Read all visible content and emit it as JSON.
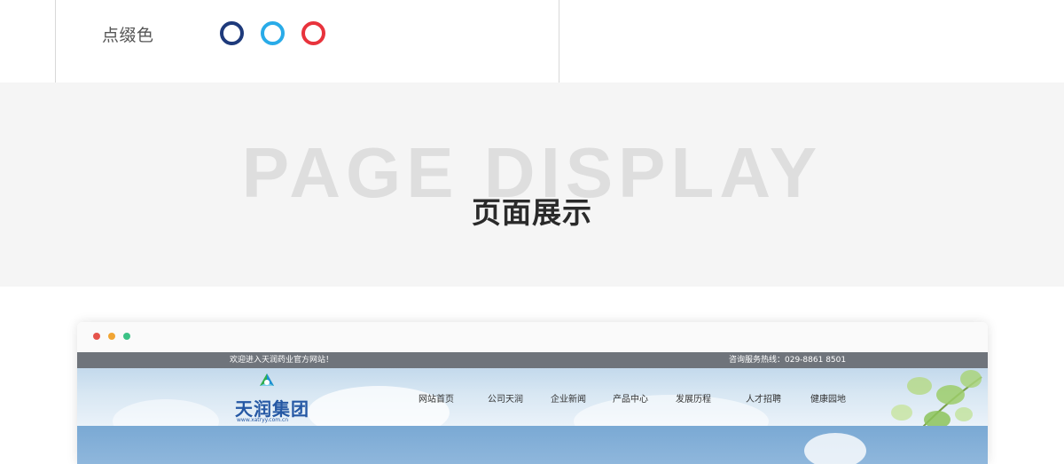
{
  "accent": {
    "label": "点缀色",
    "swatches": [
      {
        "name": "dark-blue",
        "color": "#1e3a7b"
      },
      {
        "name": "sky-blue",
        "color": "#29abe8"
      },
      {
        "name": "red",
        "color": "#e8333c"
      }
    ]
  },
  "banner": {
    "title_en": "PAGE DISPLAY",
    "title_cn": "页面展示"
  },
  "browser": {
    "dots": [
      "#e5534b",
      "#f1a534",
      "#3cc286"
    ],
    "site": {
      "welcome": "欢迎进入天润药业官方网站！",
      "hotline": "咨询服务热线：029-8861  8501",
      "logo_text": "天润集团",
      "logo_url": "www.xatryy.com.cn",
      "nav": [
        "网站首页",
        "公司天润",
        "企业新闻",
        "产品中心",
        "发展历程",
        "人才招聘",
        "健康园地"
      ]
    }
  }
}
